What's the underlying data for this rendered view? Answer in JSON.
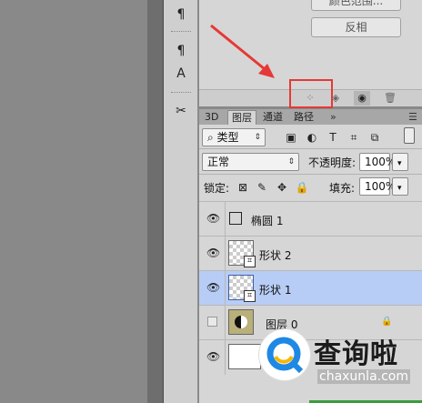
{
  "properties": {
    "button_top_label": "颜色范围...",
    "button_invert_label": "反相"
  },
  "toolstrip": {
    "items": [
      {
        "icon": "paragraph-icon",
        "glyph": "¶"
      },
      {
        "icon": "paragraph-style-icon",
        "glyph": "¶"
      },
      {
        "icon": "character-style-icon",
        "glyph": "A"
      },
      {
        "icon": "tools-icon",
        "glyph": "✂"
      }
    ]
  },
  "tabs": [
    "3D",
    "图层",
    "通道",
    "路径"
  ],
  "filter": {
    "kind_label": "类型"
  },
  "blend": {
    "mode": "正常",
    "opacity_label": "不透明度:",
    "opacity_value": "100%"
  },
  "lock": {
    "label": "锁定:",
    "fill_label": "填充:",
    "fill_value": "100%"
  },
  "layers": [
    {
      "name": "椭圆 1",
      "visible": true,
      "selected": false
    },
    {
      "name": "形状 2",
      "visible": true,
      "selected": false
    },
    {
      "name": "形状 1",
      "visible": true,
      "selected": true
    },
    {
      "name": "图层 0",
      "visible": false,
      "selected": false
    },
    {
      "name": "",
      "visible": true,
      "selected": false
    }
  ],
  "watermark": {
    "title": "查询啦",
    "subtitle": "chaxunla.com"
  },
  "colors": {
    "highlight_box": "#e53935",
    "arrow": "#e53935",
    "selected_layer": "#b8cdf5"
  }
}
